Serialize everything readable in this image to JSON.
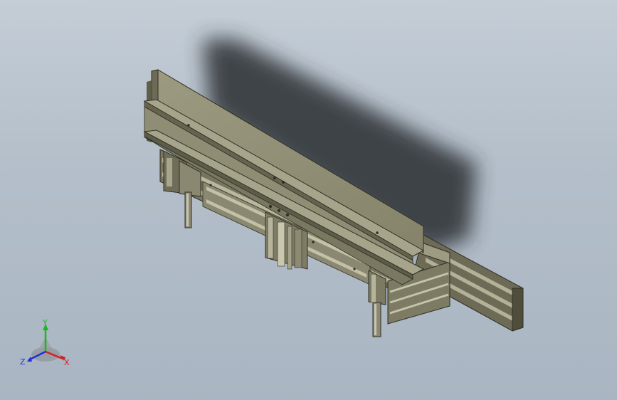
{
  "viewport": {
    "colors": {
      "background_top": "#c4cdd6",
      "background_bottom": "#a9b5c2",
      "metal_face": "#8e8c72",
      "metal_light": "#a9a78c",
      "metal_dark": "#56553f",
      "edge": "#2f2f25",
      "shadow": "#2a2d33"
    }
  },
  "triad": {
    "x_label": "X",
    "y_label": "Y",
    "z_label": "Z",
    "colors": {
      "x": "#d42020",
      "y": "#1eb520",
      "z": "#2030d8"
    }
  }
}
